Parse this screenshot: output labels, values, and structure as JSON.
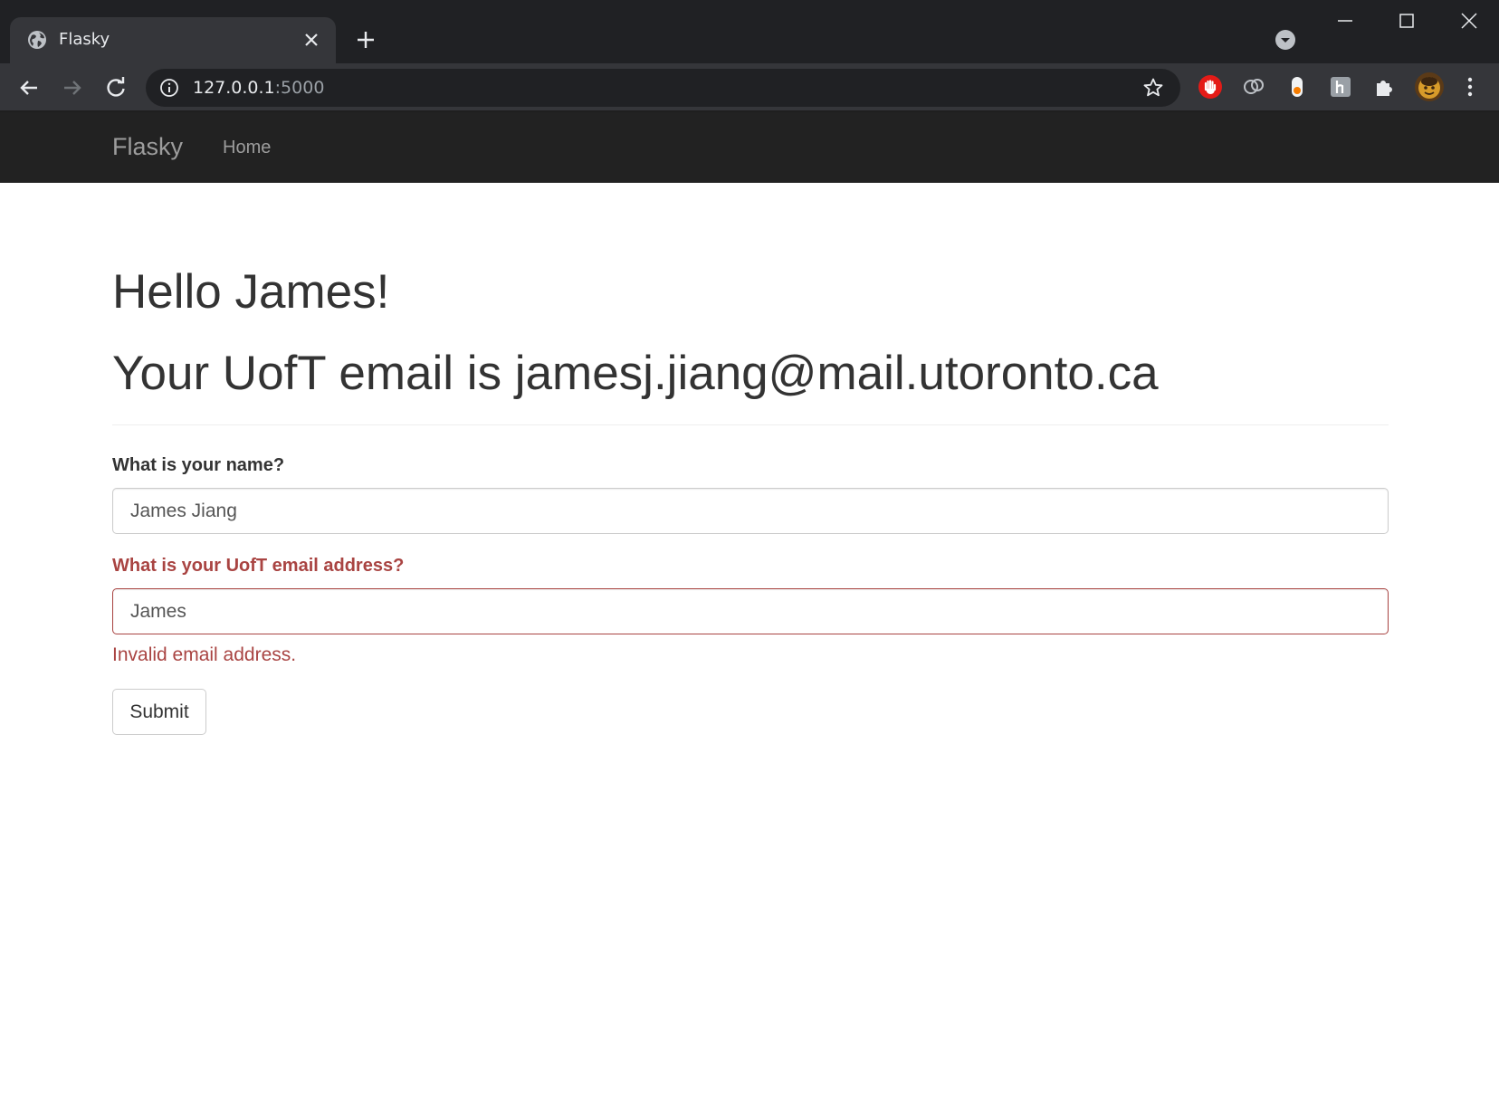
{
  "browser": {
    "tab_title": "Flasky",
    "url_host": "127.0.0.1",
    "url_port": ":5000"
  },
  "navbar": {
    "brand": "Flasky",
    "links": [
      "Home"
    ]
  },
  "page": {
    "greeting": "Hello James!",
    "email_message": "Your UofT email is jamesj.jiang@mail.utoronto.ca"
  },
  "form": {
    "name_label": "What is your name?",
    "name_value": "James Jiang",
    "email_label": "What is your UofT email address?",
    "email_value": "James",
    "email_error": "Invalid email address.",
    "submit_label": "Submit"
  },
  "colors": {
    "navbar_bg": "#222222",
    "error": "#a94442",
    "chrome_bg": "#202124"
  }
}
